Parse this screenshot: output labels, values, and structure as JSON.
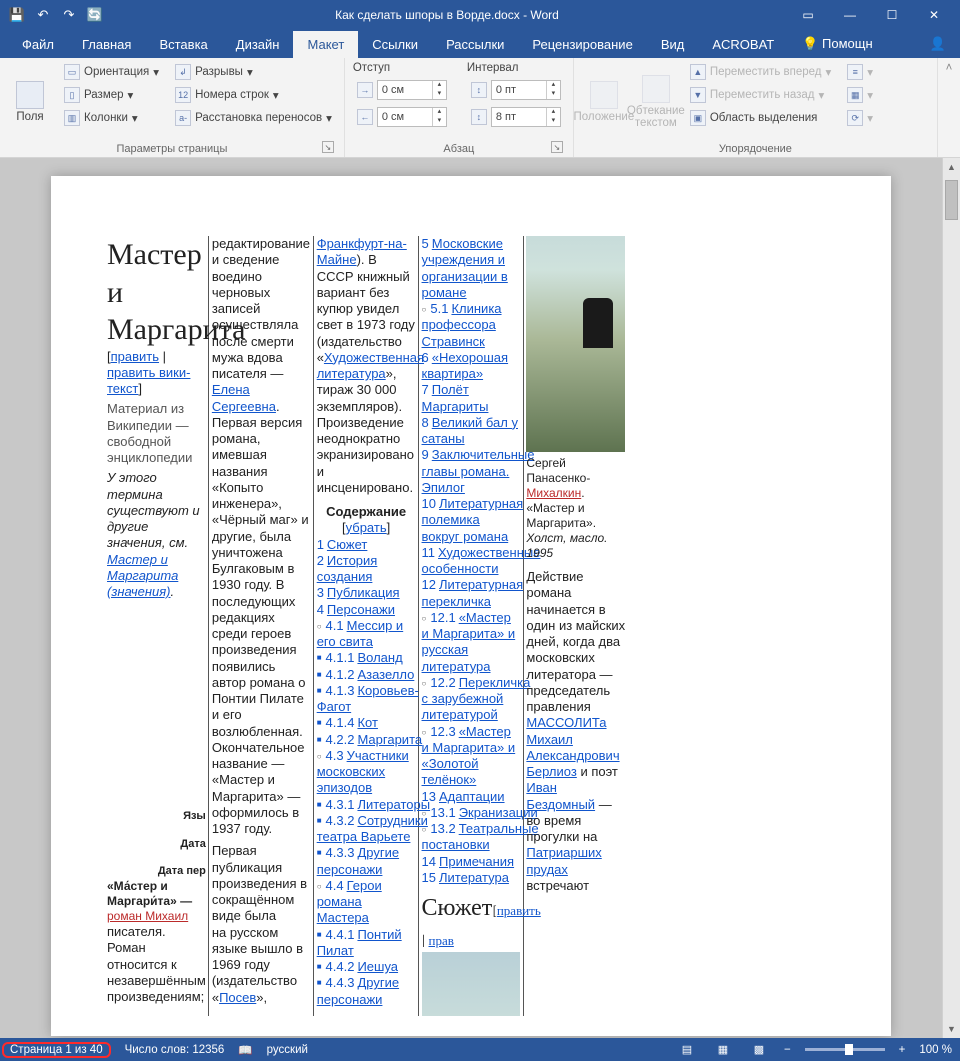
{
  "title": "Как сделать шпоры в Ворде.docx - Word",
  "qat": {
    "save": "💾",
    "undo": "↶",
    "redo": "↷",
    "sync": "🔄"
  },
  "winbtns": {
    "ribbonopts": "▭",
    "min": "—",
    "max": "☐",
    "close": "✕",
    "help": "?"
  },
  "tabs": {
    "file": "Файл",
    "home": "Главная",
    "insert": "Вставка",
    "design": "Дизайн",
    "layout": "Макет",
    "references": "Ссылки",
    "mailings": "Рассылки",
    "review": "Рецензирование",
    "view": "Вид",
    "acrobat": "ACROBAT",
    "tell": "Помощн"
  },
  "ribbon": {
    "page_setup": {
      "margins": "Поля",
      "orientation": "Ориентация",
      "size": "Размер",
      "columns": "Колонки",
      "breaks": "Разрывы",
      "line_numbers": "Номера строк",
      "hyphenation": "Расстановка переносов",
      "label": "Параметры страницы"
    },
    "paragraph": {
      "indent_label": "Отступ",
      "spacing_label": "Интервал",
      "left_val": "0 см",
      "right_val": "0 см",
      "before_val": "0 пт",
      "after_val": "8 пт",
      "label": "Абзац"
    },
    "arrange": {
      "position": "Положение",
      "wrap": "Обтекание текстом",
      "forward": "Переместить вперед",
      "backward": "Переместить назад",
      "selection_pane": "Область выделения",
      "label": "Упорядочение"
    }
  },
  "status": {
    "page": "Страница 1 из 40",
    "words": "Число слов: 12356",
    "lang": "русский",
    "zoom": "100 %"
  },
  "doc": {
    "heading": "Мастер и Маргарита",
    "edit": "править",
    "edit_wiki": "править вики-текст",
    "subtitle": "Материал из Википедии — свободной энциклопедии",
    "disambig_pre": "У этого термина существуют и другие значения, см. ",
    "disambig_link": "Мастер и Маргарита (значения)",
    "infobox_lang": "Язы",
    "infobox_date": "Дата",
    "infobox_date2": "Дата пер",
    "inf_title1": "«Ма́стер и",
    "inf_title2": "Маргари́та» —",
    "inf_title3": "роман Михаил",
    "col2": "писателя. Роман относится к незавершённым произведениям; редактирование и сведение воедино черновых записей осуществляла после смерти мужа вдова писателя — ",
    "elena": "Елена Сергеевна",
    "col2b": ". Первая версия романа, имевшая названия «Копыто инженера», «Чёрный маг» и другие, была уничтожена Булгаковым в 1930 году. В последующих редакциях среди героев произведения появились автор романа о Понтии Пилате и его возлюбленная. Окончательное название — «Мастер и Маргарита» — оформилось в 1937 году.",
    "col2c": "Первая публикация произведения в сокращённом виде была",
    "col3a": "на русском языке вышло в 1969 году (издательство «",
    "posev": "Посев",
    "col3a2": "», ",
    "frankfurt": "Франкфурт-на-Майне",
    "col3b": "). В СССР книжный вариант без купюр увидел свет в 1973 году (издательство «",
    "hudlit": "Художественная литература",
    "col3c": "», тираж 30 000 экземпляров). Произведение неоднократно экранизировано и инсценировано.",
    "contents": "Содержание",
    "hide": "убрать",
    "toc1": "Сюжет",
    "toc2": "История создания",
    "toc3": "Публикация",
    "toc4": "Персонажи",
    "toc41": "Мессир и его свита",
    "toc411": "Воланд",
    "toc412": "Азазелло",
    "toc413": "Коровьев-Фагот",
    "toc414": "Кот",
    "toc422": "Маргарита",
    "toc43": "Участники московских эпизодов",
    "toc431": "Литераторы",
    "toc432": "Сотрудники театра Варьете",
    "toc433": "Другие персонажи",
    "toc44": "Герои романа Мастера",
    "toc441": "Понтий Пилат",
    "toc442": "Иешуа",
    "toc443": "Другие персонажи",
    "toc5": "Московские учреждения и организации в романе",
    "toc51": "Клиника профессора Стравинск",
    "toc6": "«Нехорошая квартира»",
    "toc7": "Полёт Маргариты",
    "toc8": "Великий бал у сатаны",
    "toc9": "Заключительные главы романа. Эпилог",
    "toc10": "Литературная полемика вокруг романа",
    "toc11": "Художественные особенности",
    "toc12": "Литературная перекличка",
    "toc121": "«Мастер и Маргарита» и русская литература",
    "toc122": "Перекличка с зарубежной литературой",
    "toc123": "«Мастер и Маргарита» и «Золотой телёнок»",
    "toc13": "Адаптации",
    "toc131": "Экранизации",
    "toc132": "Театральные постановки",
    "toc14": "Примечания",
    "toc15": "Литература",
    "sujet": "Сюжет",
    "edit2": "править",
    "prav": "прав",
    "caption1": "Сергей Панасенко-",
    "mihalkin": "Михалкин",
    "caption2": "«Мастер и Маргарита». ",
    "caption3": "Холст, масло. 1995",
    "body7": "Действие романа начинается в один из майских дней, когда два московских литератора — председатель правления ",
    "massolit": "МАССОЛИТа",
    "berlioz_pre": "Михаил Александрович ",
    "berlioz": "Берлиоз",
    "body7b": " и поэт ",
    "bezdomny": "Иван Бездомный",
    "body7c": " — во время прогулки на ",
    "patriarshi": "Патриарших прудах",
    "body7d": " встречают"
  }
}
